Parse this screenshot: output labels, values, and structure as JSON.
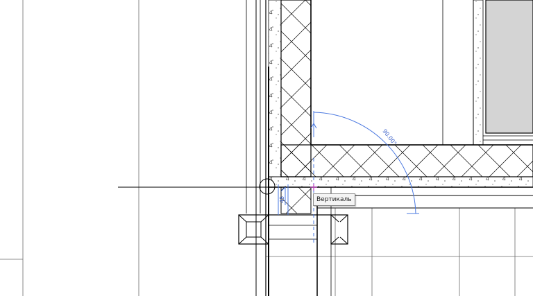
{
  "drawing": {
    "angle_label": "90.00°",
    "offset_label": "45",
    "snap_tooltip": "Вертикаль",
    "colors": {
      "line": "#000000",
      "thin_line": "#555555",
      "dimension": "#4a78e0",
      "snap_marker": "#c040c0",
      "window_fill": "#d4d4d4"
    }
  }
}
